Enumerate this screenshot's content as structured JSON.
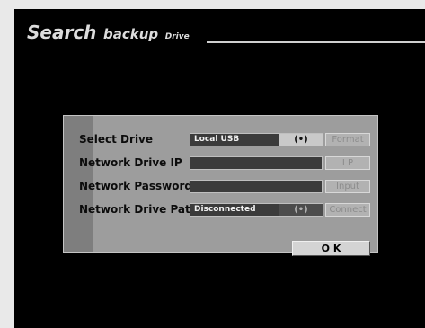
{
  "title": {
    "part1": "Search",
    "part2": "backup",
    "part3": "Drive"
  },
  "rows": [
    {
      "label": "Select Drive",
      "value": "Local USB",
      "scan_icon": "(•)",
      "button": "Format"
    },
    {
      "label": "Network Drive IP",
      "value": "",
      "button": "I P"
    },
    {
      "label": "Network Password",
      "value": "",
      "button": "Input"
    },
    {
      "label": "Network Drive Path",
      "value": "Disconnected",
      "scan_icon": "(•)",
      "button": "Connect"
    }
  ],
  "ok_label": "O K",
  "colors": {
    "screen": "#000000",
    "panel": "#9d9d9d",
    "field": "#3b3b3b"
  }
}
